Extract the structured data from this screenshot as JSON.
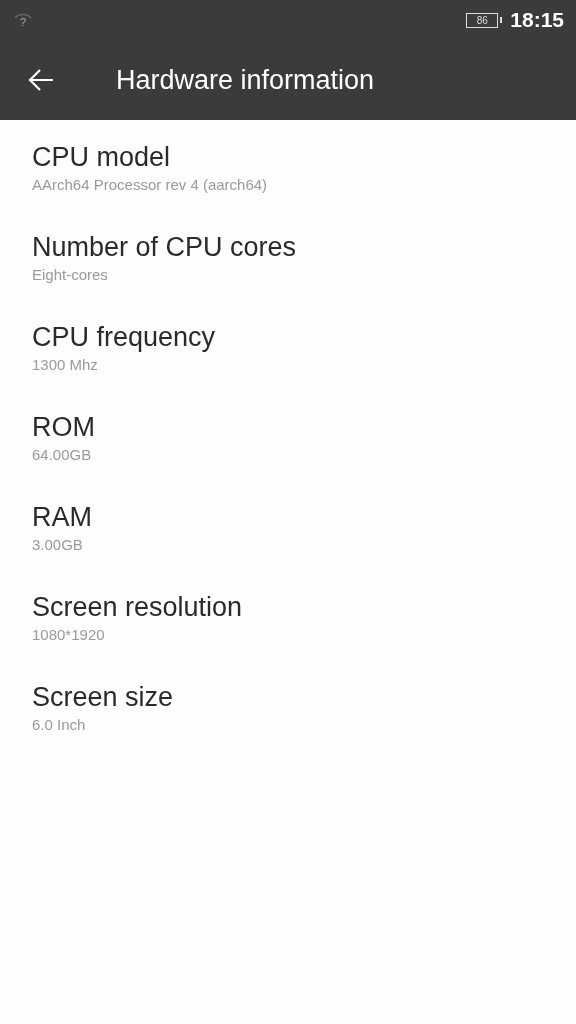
{
  "status_bar": {
    "wifi_glyph": "?",
    "battery": "86",
    "time": "18:15"
  },
  "toolbar": {
    "title": "Hardware information"
  },
  "items": [
    {
      "title": "CPU model",
      "value": "AArch64 Processor rev 4 (aarch64)"
    },
    {
      "title": "Number of CPU cores",
      "value": "Eight-cores"
    },
    {
      "title": "CPU frequency",
      "value": "1300 Mhz"
    },
    {
      "title": "ROM",
      "value": "64.00GB"
    },
    {
      "title": "RAM",
      "value": "3.00GB"
    },
    {
      "title": "Screen resolution",
      "value": "1080*1920"
    },
    {
      "title": "Screen size",
      "value": "6.0 Inch"
    }
  ]
}
